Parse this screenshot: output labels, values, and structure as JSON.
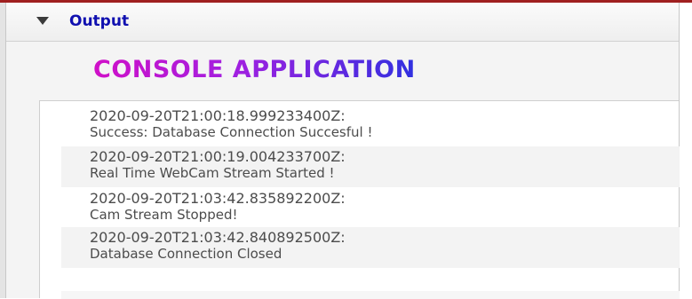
{
  "panel": {
    "header_label": "Output"
  },
  "console": {
    "title": "CONSOLE APPLICATION"
  },
  "log": [
    {
      "timestamp": "2020-09-20T21:00:18.999233400Z:",
      "message": "Success: Database Connection Succesful !"
    },
    {
      "timestamp": "2020-09-20T21:00:19.004233700Z:",
      "message": " Real Time WebCam Stream Started !"
    },
    {
      "timestamp": "2020-09-20T21:03:42.835892200Z:",
      "message": "Cam Stream Stopped!"
    },
    {
      "timestamp": "2020-09-20T21:03:42.840892500Z:",
      "message": "Database Connection Closed"
    }
  ],
  "colors": {
    "header_label": "#1010b0",
    "title_gradient_start": "#d010c8",
    "title_gradient_end": "#3030e0",
    "log_text": "#4c4c4c",
    "top_line": "#a02020"
  }
}
